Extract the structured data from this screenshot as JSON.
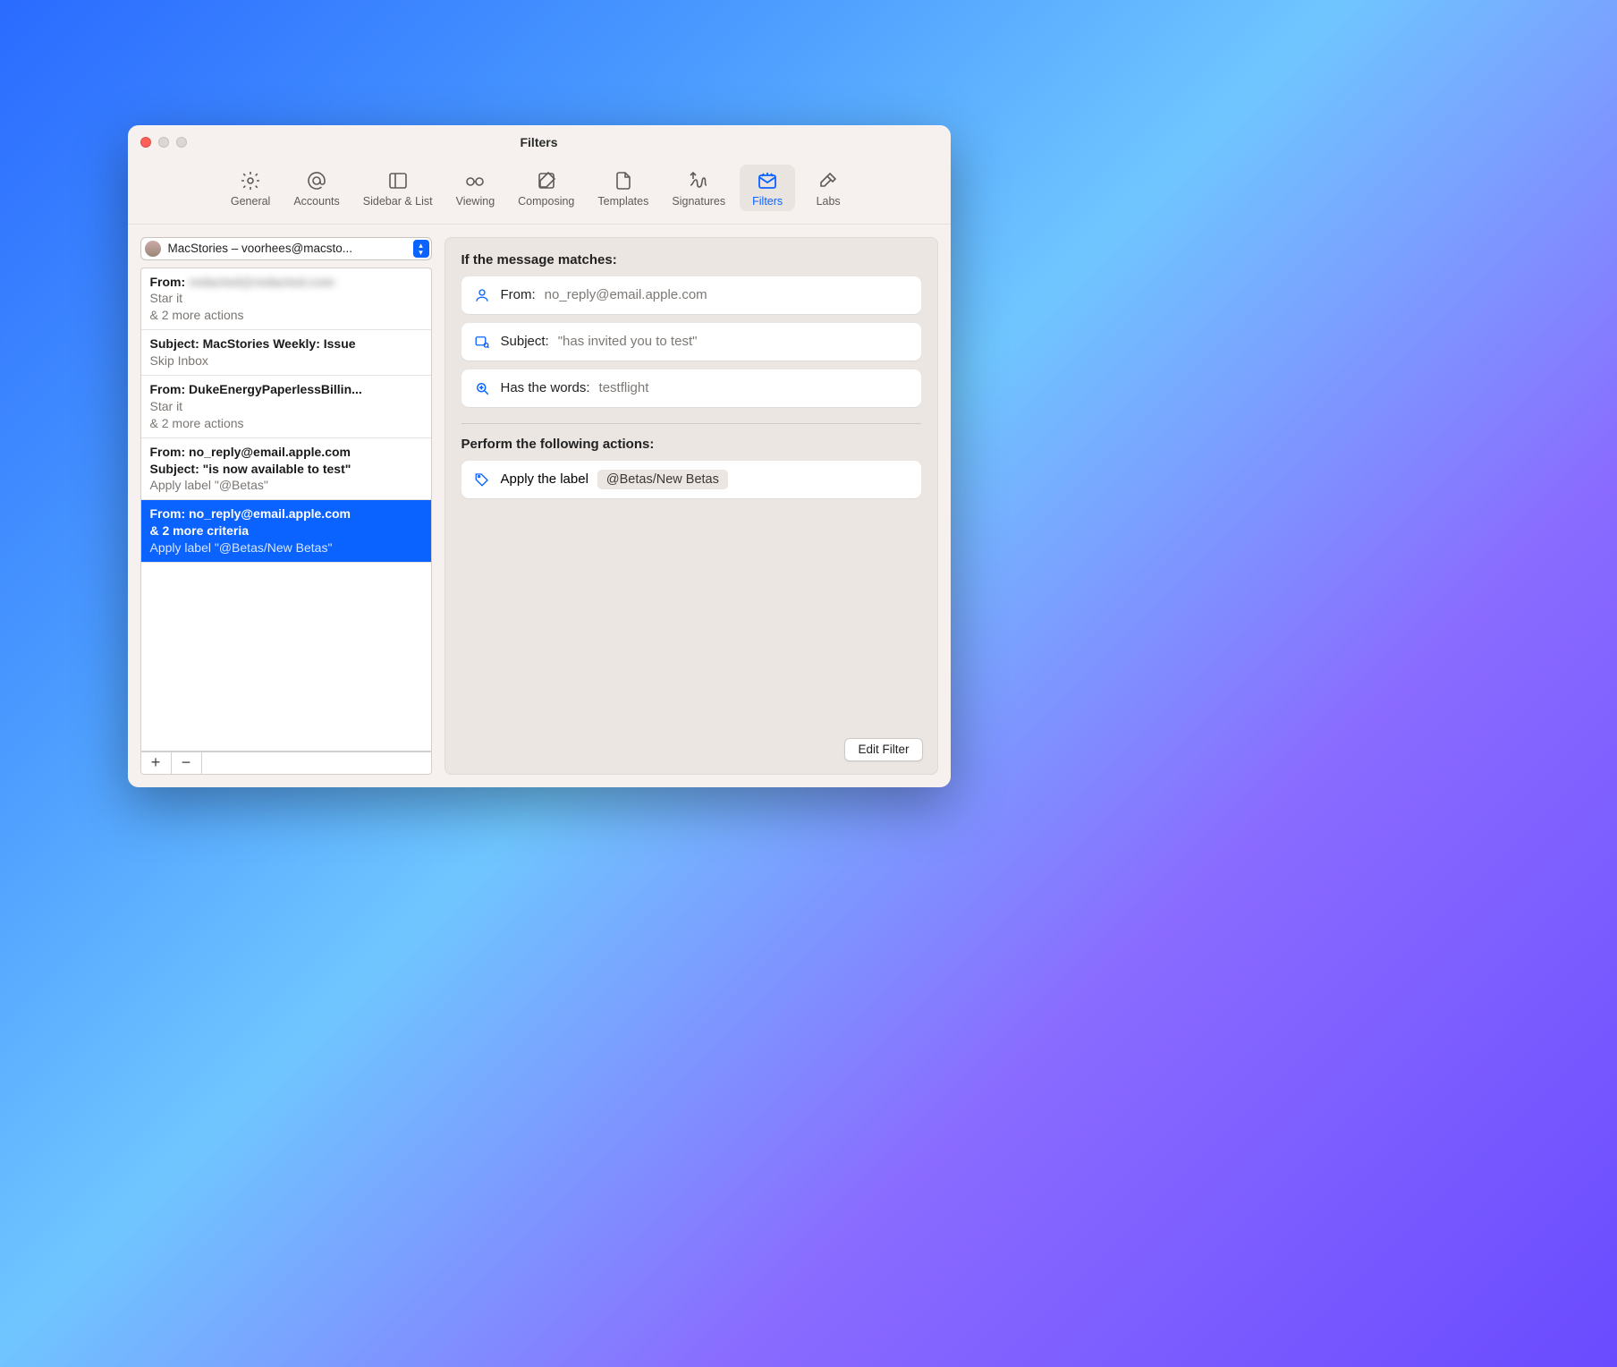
{
  "window": {
    "title": "Filters"
  },
  "toolbar": {
    "items": [
      {
        "label": "General"
      },
      {
        "label": "Accounts"
      },
      {
        "label": "Sidebar & List"
      },
      {
        "label": "Viewing"
      },
      {
        "label": "Composing"
      },
      {
        "label": "Templates"
      },
      {
        "label": "Signatures"
      },
      {
        "label": "Filters"
      },
      {
        "label": "Labs"
      }
    ]
  },
  "account_picker": {
    "text": "MacStories – voorhees@macsto..."
  },
  "filters": [
    {
      "line1": "From: ",
      "line1_blur": "redacted@redacted.com",
      "line2": "Star it",
      "line3": "& 2 more actions"
    },
    {
      "line1": "Subject: MacStories Weekly: Issue",
      "line2": "Skip Inbox"
    },
    {
      "line1": "From: DukeEnergyPaperlessBillin...",
      "line2": "Star it",
      "line3": "& 2 more actions"
    },
    {
      "line1": "From: no_reply@email.apple.com",
      "line1b": "Subject: \"is now available to test\"",
      "line2": "Apply label \"@Betas\""
    },
    {
      "line1": "From: no_reply@email.apple.com",
      "line1b": "& 2 more criteria",
      "line2": "Apply label \"@Betas/New Betas\"",
      "selected": true
    }
  ],
  "footer": {
    "add": "+",
    "remove": "−"
  },
  "detail": {
    "matches_title": "If the message matches:",
    "criteria": [
      {
        "icon": "person",
        "key": "From:",
        "value": "no_reply@email.apple.com"
      },
      {
        "icon": "subject",
        "key": "Subject:",
        "value": "\"has invited you to test\""
      },
      {
        "icon": "search",
        "key": "Has the words:",
        "value": "testflight"
      }
    ],
    "actions_title": "Perform the following actions:",
    "actions": [
      {
        "icon": "tag",
        "text": "Apply the label",
        "chip": "@Betas/New Betas"
      }
    ],
    "edit_button": "Edit Filter"
  }
}
